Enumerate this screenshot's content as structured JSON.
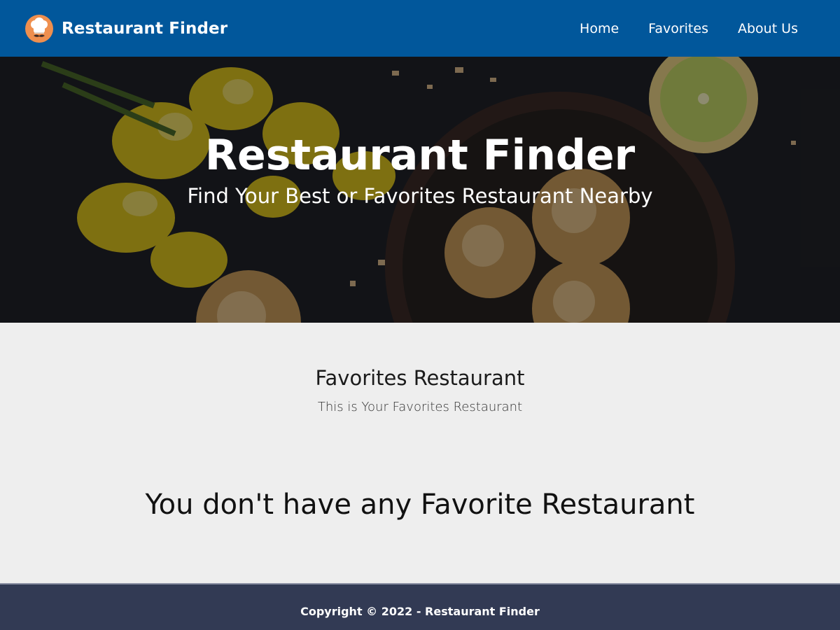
{
  "app": {
    "brand_name": "Restaurant Finder",
    "logo_icon": "chef-hat-mustache-icon",
    "brand_color": "#01579b",
    "accent_color": "#ef8f4e"
  },
  "nav": {
    "items": [
      {
        "label": "Home"
      },
      {
        "label": "Favorites"
      },
      {
        "label": "About Us"
      }
    ]
  },
  "hero": {
    "title": "Restaurant Finder",
    "subtitle": "Find Your Best or Favorites Restaurant Nearby",
    "image": "food-photo-cookies-flowers-lemon"
  },
  "main": {
    "title": "Favorites Restaurant",
    "description": "This is Your Favorites Restaurant",
    "empty_message": "You don't have any Favorite Restaurant"
  },
  "footer": {
    "copyright": "Copyright © 2022 - Restaurant Finder",
    "background": "#323a54"
  }
}
